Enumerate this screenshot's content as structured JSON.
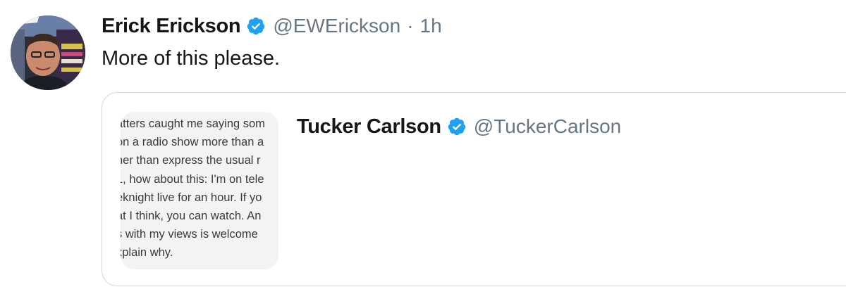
{
  "tweet": {
    "author": {
      "name": "Erick Erickson",
      "handle": "@EWErickson",
      "verified": true
    },
    "separator": "·",
    "time": "1h",
    "text": "More of this please."
  },
  "quoted_tweet": {
    "author": {
      "name": "Tucker Carlson",
      "handle": "@TuckerCarlson",
      "verified": true
    },
    "media_text_lines": [
      "atters caught me saying som",
      "on a radio show more than a",
      "ner than express the usual r",
      "1, how about this: I'm on tele",
      "eknight live for an hour. If yo",
      "at I think, you can watch. An",
      "s with my views is welcome",
      "xplain why."
    ]
  },
  "colors": {
    "text_primary": "#14171a",
    "text_secondary": "#657786",
    "verified_blue": "#1da1f2",
    "card_border": "#ccd6dd"
  },
  "icons": {
    "verified": "verified-badge-icon"
  }
}
